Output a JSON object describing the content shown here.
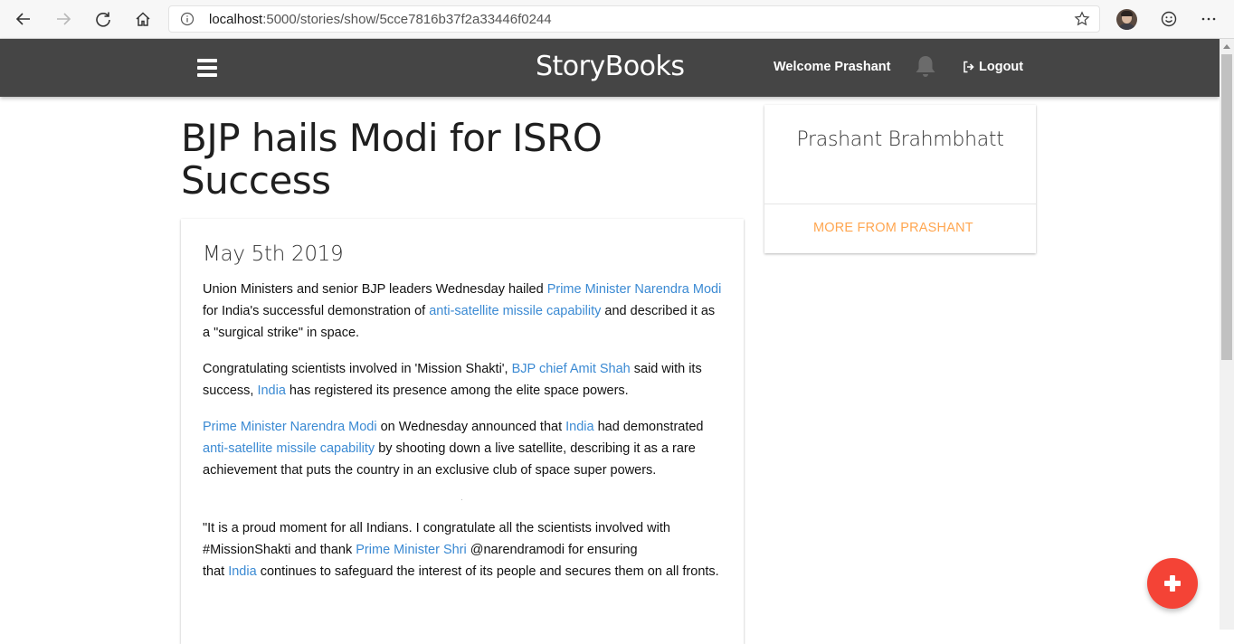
{
  "browser": {
    "url_host": "localhost",
    "url_path": ":5000/stories/show/5cce7816b37f2a33446f0244",
    "icons": [
      "back-icon",
      "forward-icon",
      "refresh-icon",
      "home-icon",
      "info-icon",
      "star-icon",
      "profile-icon",
      "emoji-icon",
      "more-icon"
    ]
  },
  "navbar": {
    "brand": "StoryBooks",
    "welcome": "Welcome Prashant",
    "logout_label": "Logout",
    "icons": [
      "menu-icon",
      "bell-icon",
      "logout-icon"
    ]
  },
  "story": {
    "title": "BJP hails Modi for ISRO Success",
    "date": "May 5th 2019",
    "p1": {
      "t1": "Union Ministers and senior BJP leaders Wednesday hailed ",
      "l1": "Prime Minister Narendra Modi",
      "t2": " for India's successful demonstration of ",
      "l2": "anti-satellite missile capability",
      "t3": " and described it as a \"surgical strike\" in space."
    },
    "p2": {
      "t1": "Congratulating scientists involved in 'Mission Shakti', ",
      "l1": "BJP chief Amit Shah",
      "t2": " said with its success, ",
      "l2": "India",
      "t3": " has registered its presence among the elite space powers."
    },
    "p3": {
      "l1": "Prime Minister Narendra Modi",
      "t1": " on Wednesday announced that ",
      "l2": "India",
      "t2": " had demonstrated ",
      "l3": "anti-satellite missile capability",
      "t3": " by shooting down a live satellite, describing it as a rare achievement that puts the country in an exclusive club of space super powers."
    },
    "p4": {
      "t1": "\"It is a proud moment for all Indians. I congratulate all the scientists involved with #MissionShakti and thank ",
      "l1": "Prime Minister Shri",
      "t2": " @narendramodi for ensuring",
      "t3": "that ",
      "l2": "India",
      "t4": " continues to safeguard the interest of its people and secures them on all fronts."
    }
  },
  "sidebar": {
    "author_name": "Prashant Brahmbhatt",
    "more_link": "MORE FROM PRASHANT"
  },
  "fab": {
    "icon": "plus-icon"
  },
  "colors": {
    "navbar_bg": "#454545",
    "link": "#3b8ad3",
    "more_link": "#ffa650",
    "fab": "#f44336"
  }
}
